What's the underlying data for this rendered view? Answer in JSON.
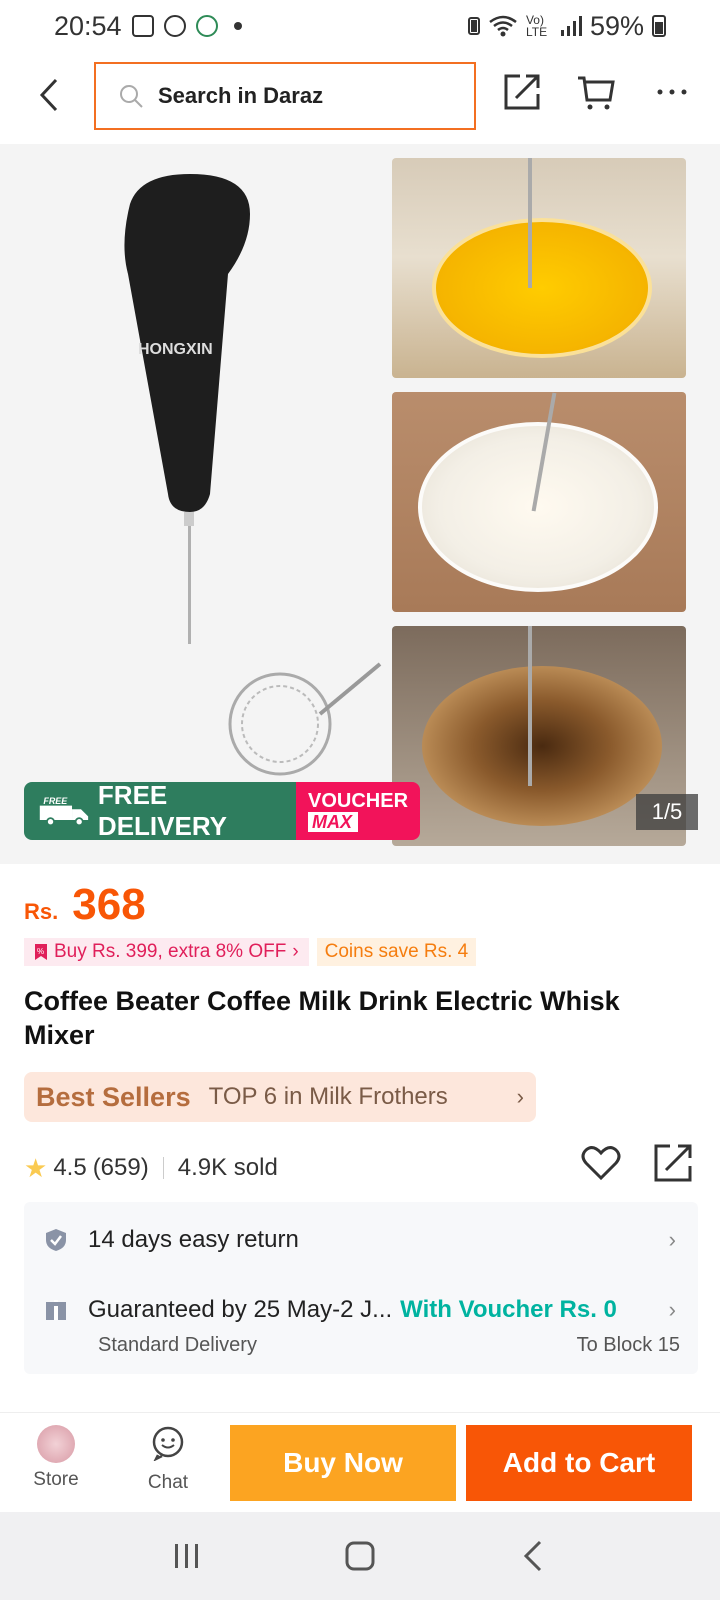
{
  "status_bar": {
    "time": "20:54",
    "battery": "59%",
    "network": "Vo) LTE"
  },
  "nav": {
    "search_placeholder": "Search in Daraz"
  },
  "gallery": {
    "brand_on_product": "HONGXIN",
    "page_indicator": "1/5",
    "promo_free_badge": "FREE",
    "promo_free_text": "FREE DELIVERY",
    "promo_voucher_top": "VOUCHER",
    "promo_voucher_bottom": "MAX"
  },
  "price": {
    "currency": "Rs.",
    "value": "368"
  },
  "promo_tags": {
    "buy_more": "Buy Rs. 399, extra 8% OFF",
    "coins": "Coins save Rs. 4"
  },
  "product": {
    "title": "Coffee Beater Coffee Milk Drink Electric Whisk Mixer"
  },
  "bestseller": {
    "label": "Best Sellers",
    "rank": "TOP 6 in Milk Frothers"
  },
  "rating": {
    "score": "4.5",
    "count": "(659)",
    "sold": "4.9K sold"
  },
  "service": {
    "return_text": "14 days easy return",
    "delivery_text": "Guaranteed by 25 May-2 J...",
    "delivery_voucher": "With Voucher Rs. 0",
    "delivery_type": "Standard Delivery",
    "delivery_to": "To Block 15"
  },
  "action_bar": {
    "store_label": "Store",
    "chat_label": "Chat",
    "buy_now": "Buy Now",
    "add_to_cart": "Add to Cart"
  },
  "colors": {
    "brand_orange": "#f85606",
    "buy_now": "#fca421",
    "delivery_green": "#2e7d5e",
    "voucher_pink": "#f2135a",
    "teal": "#00b3a0"
  }
}
